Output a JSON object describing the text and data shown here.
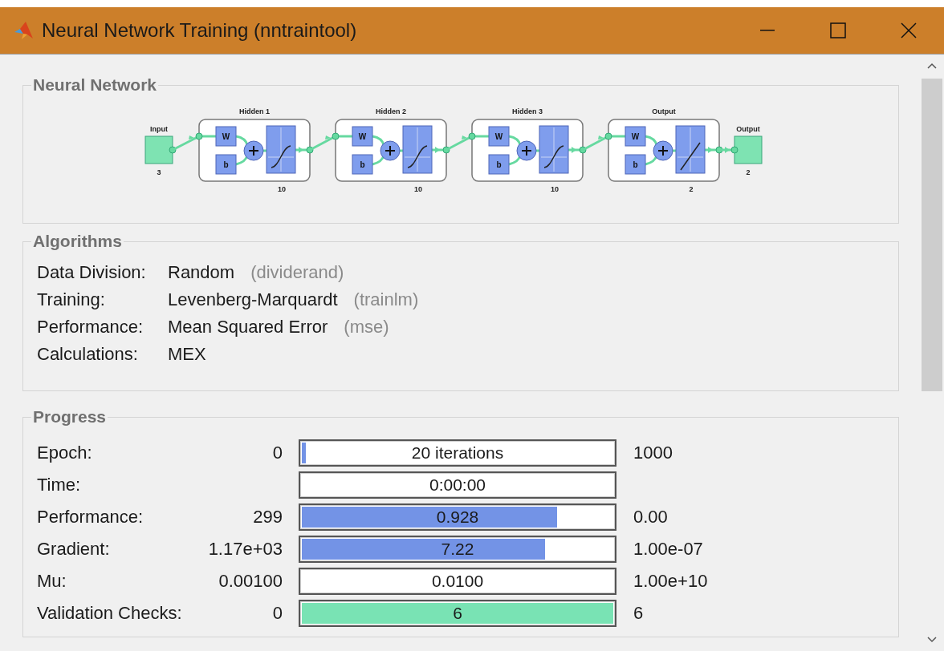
{
  "window": {
    "title": "Neural Network Training (nntraintool)"
  },
  "network": {
    "title": "Neural Network",
    "input": {
      "label": "Input",
      "size": "3"
    },
    "layers": [
      {
        "name": "Hidden 1",
        "size": "10",
        "weight": "W",
        "bias": "b",
        "kind": "sigmoid"
      },
      {
        "name": "Hidden 2",
        "size": "10",
        "weight": "W",
        "bias": "b",
        "kind": "sigmoid"
      },
      {
        "name": "Hidden 3",
        "size": "10",
        "weight": "W",
        "bias": "b",
        "kind": "sigmoid"
      },
      {
        "name": "Output",
        "size": "2",
        "weight": "W",
        "bias": "b",
        "kind": "linear"
      }
    ],
    "output": {
      "label": "Output",
      "size": "2"
    }
  },
  "algorithms": {
    "title": "Algorithms",
    "rows": [
      {
        "label": "Data Division:",
        "value": "Random",
        "function": "(dividerand)"
      },
      {
        "label": "Training:",
        "value": "Levenberg-Marquardt",
        "function": "(trainlm)"
      },
      {
        "label": "Performance:",
        "value": "Mean Squared Error",
        "function": "(mse)"
      },
      {
        "label": "Calculations:",
        "value": "MEX"
      }
    ]
  },
  "progress": {
    "title": "Progress",
    "rows": [
      {
        "label": "Epoch:",
        "start": "0",
        "value": "20 iterations",
        "level": 0.012,
        "kind": "measure",
        "end": "1000"
      },
      {
        "label": "Time:",
        "value": "0:00:00",
        "level": 0,
        "kind": "measure"
      },
      {
        "label": "Performance:",
        "start": "299",
        "value": "0.928",
        "level": 0.82,
        "kind": "measure",
        "end": "0.00"
      },
      {
        "label": "Gradient:",
        "start": "1.17e+03",
        "value": "7.22",
        "level": 0.78,
        "kind": "measure",
        "end": "1.00e-07"
      },
      {
        "label": "Mu:",
        "start": "0.00100",
        "value": "0.0100",
        "level": 0,
        "kind": "measure",
        "end": "1.00e+10"
      },
      {
        "label": "Validation Checks:",
        "start": "0",
        "value": "6",
        "level": 1,
        "kind": "check",
        "end": "6"
      }
    ]
  }
}
